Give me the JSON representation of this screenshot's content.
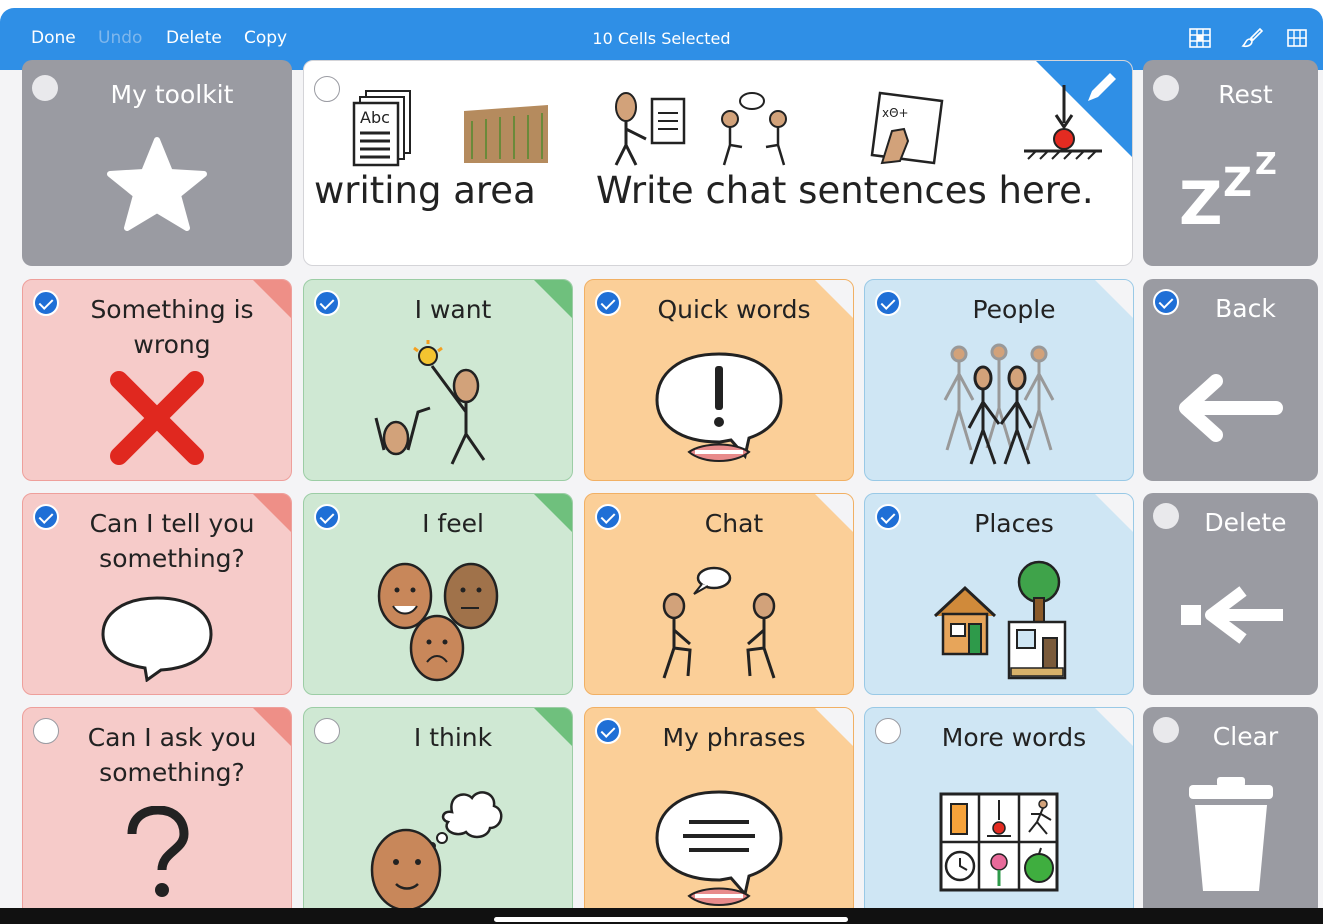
{
  "toolbar": {
    "done": "Done",
    "undo": "Undo",
    "delete": "Delete",
    "copy": "Copy",
    "title": "10 Cells Selected",
    "icons": [
      "grid-style-icon",
      "paint-brush-icon",
      "grid-icon"
    ],
    "color": "#2f8fe6"
  },
  "writing_area": {
    "label_left": "writing area",
    "label_right": "Write chat sentences here.",
    "selected": false
  },
  "cells": {
    "my_toolkit": {
      "label": "My toolkit",
      "selected": false,
      "icon": "star-icon"
    },
    "rest": {
      "label": "Rest",
      "selected": false,
      "icon": "zzz-icon"
    },
    "something_wrong": {
      "label": "Something is wrong",
      "selected": true,
      "icon": "red-cross-icon"
    },
    "i_want": {
      "label": "I want",
      "selected": true,
      "icon": "i-want-symbol-icon"
    },
    "quick_words": {
      "label": "Quick words",
      "selected": true,
      "icon": "exclamation-speech-icon"
    },
    "people": {
      "label": "People",
      "selected": true,
      "icon": "people-group-icon"
    },
    "back": {
      "label": "Back",
      "selected": true,
      "icon": "back-arrow-icon"
    },
    "tell_you": {
      "label": "Can I tell you something?",
      "selected": true,
      "icon": "speech-bubble-icon"
    },
    "i_feel": {
      "label": "I feel",
      "selected": true,
      "icon": "faces-icon"
    },
    "chat": {
      "label": "Chat",
      "selected": true,
      "icon": "two-people-chatting-icon"
    },
    "places": {
      "label": "Places",
      "selected": true,
      "icon": "house-tree-icon"
    },
    "delete": {
      "label": "Delete",
      "selected": false,
      "icon": "backspace-icon"
    },
    "ask_you": {
      "label": "Can I ask you something?",
      "selected": false,
      "icon": "question-mark-icon"
    },
    "i_think": {
      "label": "I think",
      "selected": false,
      "icon": "thinking-face-icon"
    },
    "my_phrases": {
      "label": "My phrases",
      "selected": true,
      "icon": "phrases-speech-icon"
    },
    "more_words": {
      "label": "More words",
      "selected": false,
      "icon": "words-grid-icon"
    },
    "clear": {
      "label": "Clear",
      "selected": false,
      "icon": "trash-can-icon"
    }
  },
  "colors": {
    "red": "#f6cbc9",
    "green": "#cfe8d3",
    "orange": "#fbcf98",
    "blue": "#cfe6f4",
    "gray": "#9a9ba2",
    "check": "#1f6fd6"
  }
}
